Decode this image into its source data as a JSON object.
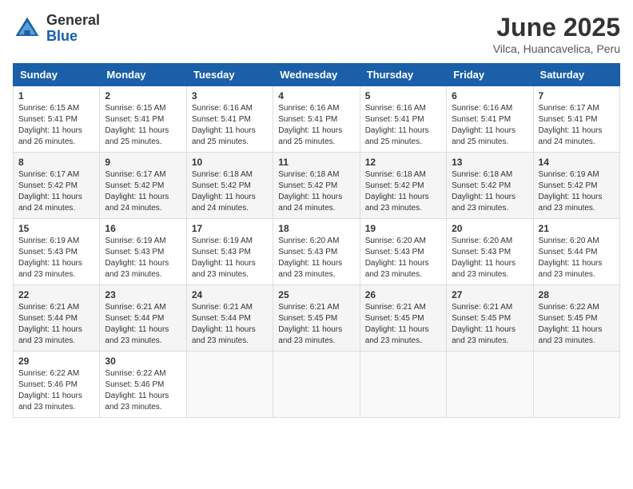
{
  "header": {
    "logo_general": "General",
    "logo_blue": "Blue",
    "month": "June 2025",
    "location": "Vilca, Huancavelica, Peru"
  },
  "weekdays": [
    "Sunday",
    "Monday",
    "Tuesday",
    "Wednesday",
    "Thursday",
    "Friday",
    "Saturday"
  ],
  "weeks": [
    [
      {
        "day": "1",
        "text": "Sunrise: 6:15 AM\nSunset: 5:41 PM\nDaylight: 11 hours\nand 26 minutes."
      },
      {
        "day": "2",
        "text": "Sunrise: 6:15 AM\nSunset: 5:41 PM\nDaylight: 11 hours\nand 25 minutes."
      },
      {
        "day": "3",
        "text": "Sunrise: 6:16 AM\nSunset: 5:41 PM\nDaylight: 11 hours\nand 25 minutes."
      },
      {
        "day": "4",
        "text": "Sunrise: 6:16 AM\nSunset: 5:41 PM\nDaylight: 11 hours\nand 25 minutes."
      },
      {
        "day": "5",
        "text": "Sunrise: 6:16 AM\nSunset: 5:41 PM\nDaylight: 11 hours\nand 25 minutes."
      },
      {
        "day": "6",
        "text": "Sunrise: 6:16 AM\nSunset: 5:41 PM\nDaylight: 11 hours\nand 25 minutes."
      },
      {
        "day": "7",
        "text": "Sunrise: 6:17 AM\nSunset: 5:41 PM\nDaylight: 11 hours\nand 24 minutes."
      }
    ],
    [
      {
        "day": "8",
        "text": "Sunrise: 6:17 AM\nSunset: 5:42 PM\nDaylight: 11 hours\nand 24 minutes."
      },
      {
        "day": "9",
        "text": "Sunrise: 6:17 AM\nSunset: 5:42 PM\nDaylight: 11 hours\nand 24 minutes."
      },
      {
        "day": "10",
        "text": "Sunrise: 6:18 AM\nSunset: 5:42 PM\nDaylight: 11 hours\nand 24 minutes."
      },
      {
        "day": "11",
        "text": "Sunrise: 6:18 AM\nSunset: 5:42 PM\nDaylight: 11 hours\nand 24 minutes."
      },
      {
        "day": "12",
        "text": "Sunrise: 6:18 AM\nSunset: 5:42 PM\nDaylight: 11 hours\nand 23 minutes."
      },
      {
        "day": "13",
        "text": "Sunrise: 6:18 AM\nSunset: 5:42 PM\nDaylight: 11 hours\nand 23 minutes."
      },
      {
        "day": "14",
        "text": "Sunrise: 6:19 AM\nSunset: 5:42 PM\nDaylight: 11 hours\nand 23 minutes."
      }
    ],
    [
      {
        "day": "15",
        "text": "Sunrise: 6:19 AM\nSunset: 5:43 PM\nDaylight: 11 hours\nand 23 minutes."
      },
      {
        "day": "16",
        "text": "Sunrise: 6:19 AM\nSunset: 5:43 PM\nDaylight: 11 hours\nand 23 minutes."
      },
      {
        "day": "17",
        "text": "Sunrise: 6:19 AM\nSunset: 5:43 PM\nDaylight: 11 hours\nand 23 minutes."
      },
      {
        "day": "18",
        "text": "Sunrise: 6:20 AM\nSunset: 5:43 PM\nDaylight: 11 hours\nand 23 minutes."
      },
      {
        "day": "19",
        "text": "Sunrise: 6:20 AM\nSunset: 5:43 PM\nDaylight: 11 hours\nand 23 minutes."
      },
      {
        "day": "20",
        "text": "Sunrise: 6:20 AM\nSunset: 5:43 PM\nDaylight: 11 hours\nand 23 minutes."
      },
      {
        "day": "21",
        "text": "Sunrise: 6:20 AM\nSunset: 5:44 PM\nDaylight: 11 hours\nand 23 minutes."
      }
    ],
    [
      {
        "day": "22",
        "text": "Sunrise: 6:21 AM\nSunset: 5:44 PM\nDaylight: 11 hours\nand 23 minutes."
      },
      {
        "day": "23",
        "text": "Sunrise: 6:21 AM\nSunset: 5:44 PM\nDaylight: 11 hours\nand 23 minutes."
      },
      {
        "day": "24",
        "text": "Sunrise: 6:21 AM\nSunset: 5:44 PM\nDaylight: 11 hours\nand 23 minutes."
      },
      {
        "day": "25",
        "text": "Sunrise: 6:21 AM\nSunset: 5:45 PM\nDaylight: 11 hours\nand 23 minutes."
      },
      {
        "day": "26",
        "text": "Sunrise: 6:21 AM\nSunset: 5:45 PM\nDaylight: 11 hours\nand 23 minutes."
      },
      {
        "day": "27",
        "text": "Sunrise: 6:21 AM\nSunset: 5:45 PM\nDaylight: 11 hours\nand 23 minutes."
      },
      {
        "day": "28",
        "text": "Sunrise: 6:22 AM\nSunset: 5:45 PM\nDaylight: 11 hours\nand 23 minutes."
      }
    ],
    [
      {
        "day": "29",
        "text": "Sunrise: 6:22 AM\nSunset: 5:46 PM\nDaylight: 11 hours\nand 23 minutes."
      },
      {
        "day": "30",
        "text": "Sunrise: 6:22 AM\nSunset: 5:46 PM\nDaylight: 11 hours\nand 23 minutes."
      },
      {
        "day": "",
        "text": ""
      },
      {
        "day": "",
        "text": ""
      },
      {
        "day": "",
        "text": ""
      },
      {
        "day": "",
        "text": ""
      },
      {
        "day": "",
        "text": ""
      }
    ]
  ]
}
